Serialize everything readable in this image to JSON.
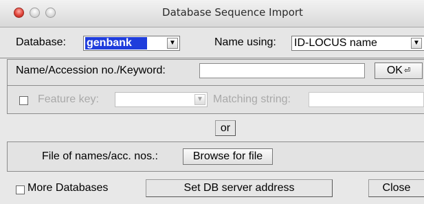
{
  "window": {
    "title": "Database Sequence Import"
  },
  "database_row": {
    "database_label": "Database:",
    "database_value": "genbank",
    "name_using_label": "Name using:",
    "name_using_value": "ID-LOCUS name"
  },
  "query": {
    "keyword_label": "Name/Accession no./Keyword:",
    "keyword_value": "",
    "ok_label": "OK",
    "ok_glyph": "⏎",
    "feature_key_label": "Feature key:",
    "feature_key_value": "",
    "feature_key_checked": false,
    "matching_string_label": "Matching string:",
    "matching_string_value": ""
  },
  "or_label": "or",
  "file": {
    "label": "File of names/acc. nos.:",
    "browse_label": "Browse for file"
  },
  "footer": {
    "more_databases_label": "More Databases",
    "more_databases_checked": false,
    "set_server_label": "Set DB server address",
    "close_label": "Close"
  },
  "colors": {
    "selection": "#1f3ddc",
    "close_dot": "#e0443a"
  }
}
